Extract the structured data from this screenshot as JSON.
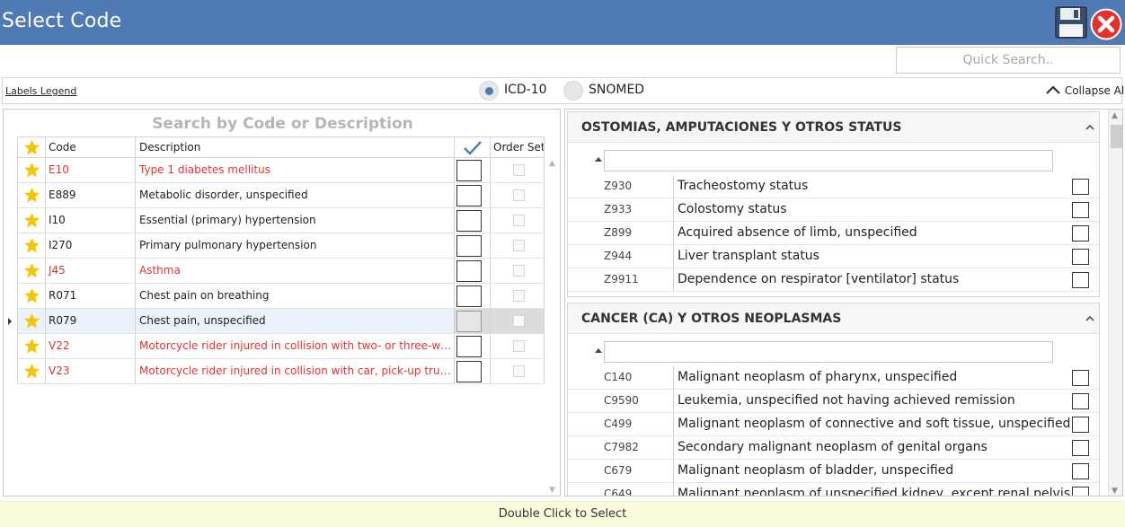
{
  "window": {
    "title": "Select Code"
  },
  "toolbar": {
    "save_icon": "floppy-disk-icon",
    "close_icon": "close-circle-icon",
    "close_color": "#e4322b"
  },
  "search": {
    "quick_placeholder": "Quick Search.."
  },
  "options": {
    "legend_label": "Labels Legend",
    "radios": [
      {
        "label": "ICD-10",
        "selected": true
      },
      {
        "label": "SNOMED",
        "selected": false
      }
    ],
    "collapse_all_label": "Collapse All"
  },
  "left": {
    "title": "Search by Code or Description",
    "headers": {
      "code": "Code",
      "description": "Description",
      "check_icon": "checkmark-icon",
      "order_set": "Order Set"
    },
    "rows": [
      {
        "code": "E10",
        "description": "Type 1 diabetes mellitus",
        "red": true
      },
      {
        "code": "E889",
        "description": "Metabolic disorder, unspecified",
        "red": false
      },
      {
        "code": "I10",
        "description": "Essential (primary) hypertension",
        "red": false
      },
      {
        "code": "I270",
        "description": "Primary pulmonary hypertension",
        "red": false
      },
      {
        "code": "J45",
        "description": "Asthma",
        "red": true
      },
      {
        "code": "R071",
        "description": "Chest pain on breathing",
        "red": false
      },
      {
        "code": "R079",
        "description": "Chest pain, unspecified",
        "red": false,
        "selected": true
      },
      {
        "code": "V22",
        "description": "Motorcycle rider injured in collision with two- or three-wheeled motor vehicle",
        "red": true
      },
      {
        "code": "V23",
        "description": "Motorcycle rider injured in collision with car, pick-up truck or van",
        "red": true
      }
    ]
  },
  "right": {
    "groups": [
      {
        "title": "OSTOMIAS, AMPUTACIONES Y OTROS STATUS",
        "rows": [
          {
            "code": "Z930",
            "description": "Tracheostomy status"
          },
          {
            "code": "Z933",
            "description": "Colostomy status"
          },
          {
            "code": "Z899",
            "description": "Acquired absence of limb, unspecified"
          },
          {
            "code": "Z944",
            "description": "Liver transplant status"
          },
          {
            "code": "Z9911",
            "description": "Dependence on respirator [ventilator] status"
          }
        ]
      },
      {
        "title": "CANCER (CA) Y OTROS NEOPLASMAS",
        "rows": [
          {
            "code": "C140",
            "description": "Malignant neoplasm of pharynx, unspecified"
          },
          {
            "code": "C9590",
            "description": "Leukemia, unspecified not having achieved remission"
          },
          {
            "code": "C499",
            "description": "Malignant neoplasm of connective and soft tissue, unspecified"
          },
          {
            "code": "C7982",
            "description": "Secondary malignant neoplasm of genital organs"
          },
          {
            "code": "C679",
            "description": "Malignant neoplasm of bladder, unspecified"
          },
          {
            "code": "C649",
            "description": "Malignant neoplasm of unspecified kidney, except renal pelvis"
          }
        ]
      }
    ]
  },
  "footer": {
    "hint": "Double Click to Select"
  },
  "colors": {
    "titlebar": "#4f7ab3",
    "red_text": "#e4322b",
    "star": "#f6c500",
    "footer_bg": "#fbfbde"
  }
}
